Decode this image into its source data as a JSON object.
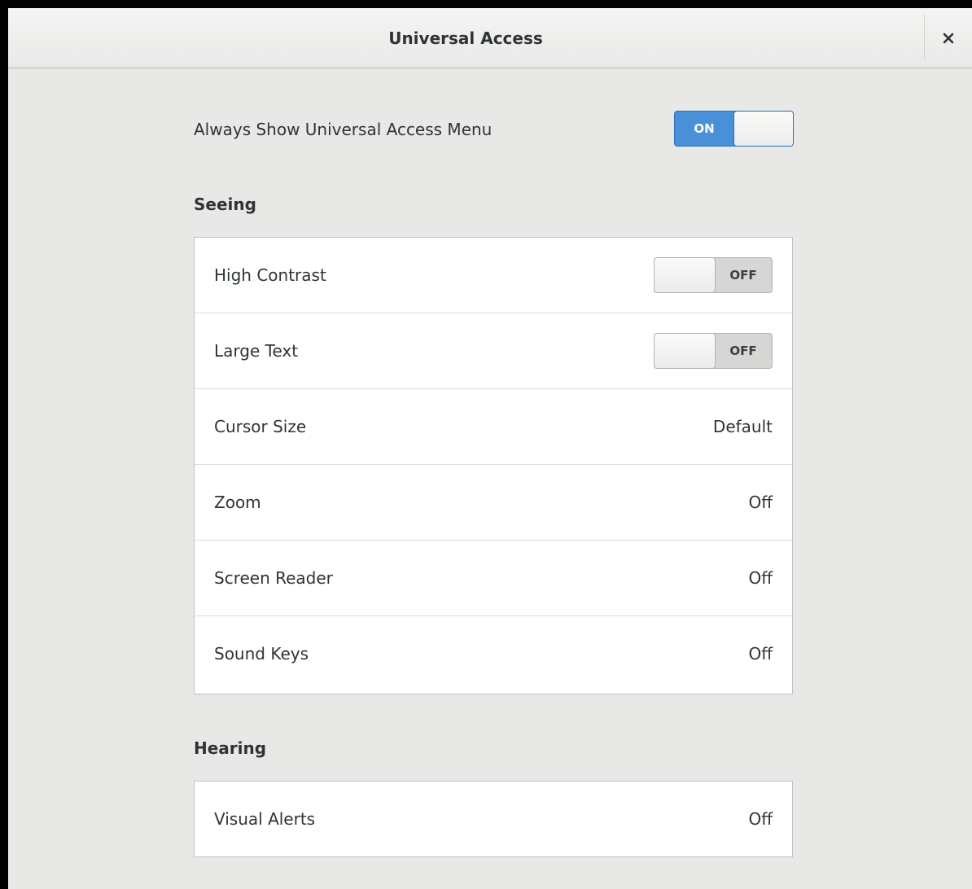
{
  "window": {
    "title": "Universal Access",
    "close_icon": "close-icon"
  },
  "menu": {
    "label": "Always Show Universal Access Menu",
    "switch_text": "ON",
    "state": true
  },
  "seeing": {
    "heading": "Seeing",
    "rows": [
      {
        "label": "High Contrast",
        "type": "switch",
        "value": "OFF"
      },
      {
        "label": "Large Text",
        "type": "switch",
        "value": "OFF"
      },
      {
        "label": "Cursor Size",
        "type": "value",
        "value": "Default"
      },
      {
        "label": "Zoom",
        "type": "value",
        "value": "Off"
      },
      {
        "label": "Screen Reader",
        "type": "value",
        "value": "Off"
      },
      {
        "label": "Sound Keys",
        "type": "value",
        "value": "Off"
      }
    ]
  },
  "hearing": {
    "heading": "Hearing",
    "rows": [
      {
        "label": "Visual Alerts",
        "type": "value",
        "value": "Off"
      }
    ]
  },
  "colors": {
    "accent": "#4a90d9",
    "window_bg": "#e8e8e7",
    "text": "#2e3436"
  }
}
